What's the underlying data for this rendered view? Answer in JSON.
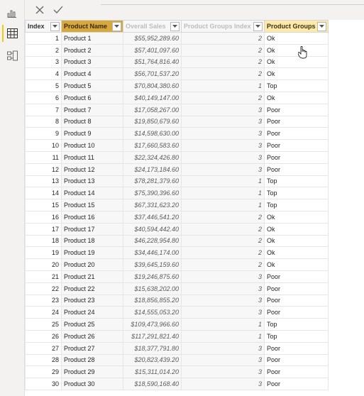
{
  "sidebar": {
    "items": [
      {
        "name": "report-view-icon"
      },
      {
        "name": "data-view-icon",
        "active": true
      },
      {
        "name": "model-view-icon"
      }
    ]
  },
  "formula_bar": {
    "cancel_icon": "close-icon",
    "commit_icon": "check-icon"
  },
  "table": {
    "columns": [
      "Index",
      "Product Name",
      "Overall Sales",
      "Product Groups Index",
      "Product Groups"
    ],
    "rows": [
      [
        "1",
        "Product 1",
        "$55,952,289.60",
        "2",
        "Ok"
      ],
      [
        "2",
        "Product 2",
        "$57,401,097.60",
        "2",
        "Ok"
      ],
      [
        "3",
        "Product 3",
        "$51,764,816.40",
        "2",
        "Ok"
      ],
      [
        "4",
        "Product 4",
        "$56,701,537.20",
        "2",
        "Ok"
      ],
      [
        "5",
        "Product 5",
        "$70,804,380.60",
        "1",
        "Top"
      ],
      [
        "6",
        "Product 6",
        "$40,149,147.00",
        "2",
        "Ok"
      ],
      [
        "7",
        "Product 7",
        "$17,058,267.00",
        "3",
        "Poor"
      ],
      [
        "8",
        "Product 8",
        "$19,850,679.60",
        "3",
        "Poor"
      ],
      [
        "9",
        "Product 9",
        "$14,598,630.00",
        "3",
        "Poor"
      ],
      [
        "10",
        "Product 10",
        "$17,660,583.60",
        "3",
        "Poor"
      ],
      [
        "11",
        "Product 11",
        "$22,324,426.80",
        "3",
        "Poor"
      ],
      [
        "12",
        "Product 12",
        "$24,173,184.60",
        "3",
        "Poor"
      ],
      [
        "13",
        "Product 13",
        "$78,281,379.60",
        "1",
        "Top"
      ],
      [
        "14",
        "Product 14",
        "$75,390,396.60",
        "1",
        "Top"
      ],
      [
        "15",
        "Product 15",
        "$67,331,623.20",
        "1",
        "Top"
      ],
      [
        "16",
        "Product 16",
        "$37,446,541.20",
        "2",
        "Ok"
      ],
      [
        "17",
        "Product 17",
        "$40,594,442.40",
        "2",
        "Ok"
      ],
      [
        "18",
        "Product 18",
        "$46,228,954.80",
        "2",
        "Ok"
      ],
      [
        "19",
        "Product 19",
        "$34,446,174.00",
        "2",
        "Ok"
      ],
      [
        "20",
        "Product 20",
        "$39,645,159.60",
        "2",
        "Ok"
      ],
      [
        "21",
        "Product 21",
        "$19,246,875.60",
        "3",
        "Poor"
      ],
      [
        "22",
        "Product 22",
        "$15,638,202.00",
        "3",
        "Poor"
      ],
      [
        "23",
        "Product 23",
        "$18,856,855.20",
        "3",
        "Poor"
      ],
      [
        "24",
        "Product 24",
        "$14,555,053.20",
        "3",
        "Poor"
      ],
      [
        "25",
        "Product 25",
        "$109,473,966.60",
        "1",
        "Top"
      ],
      [
        "26",
        "Product 26",
        "$117,291,821.40",
        "1",
        "Top"
      ],
      [
        "27",
        "Product 27",
        "$18,377,791.80",
        "3",
        "Poor"
      ],
      [
        "28",
        "Product 28",
        "$20,823,439.20",
        "3",
        "Poor"
      ],
      [
        "29",
        "Product 29",
        "$15,311,014.20",
        "3",
        "Poor"
      ],
      [
        "30",
        "Product 30",
        "$18,590,168.40",
        "3",
        "Poor"
      ]
    ]
  }
}
